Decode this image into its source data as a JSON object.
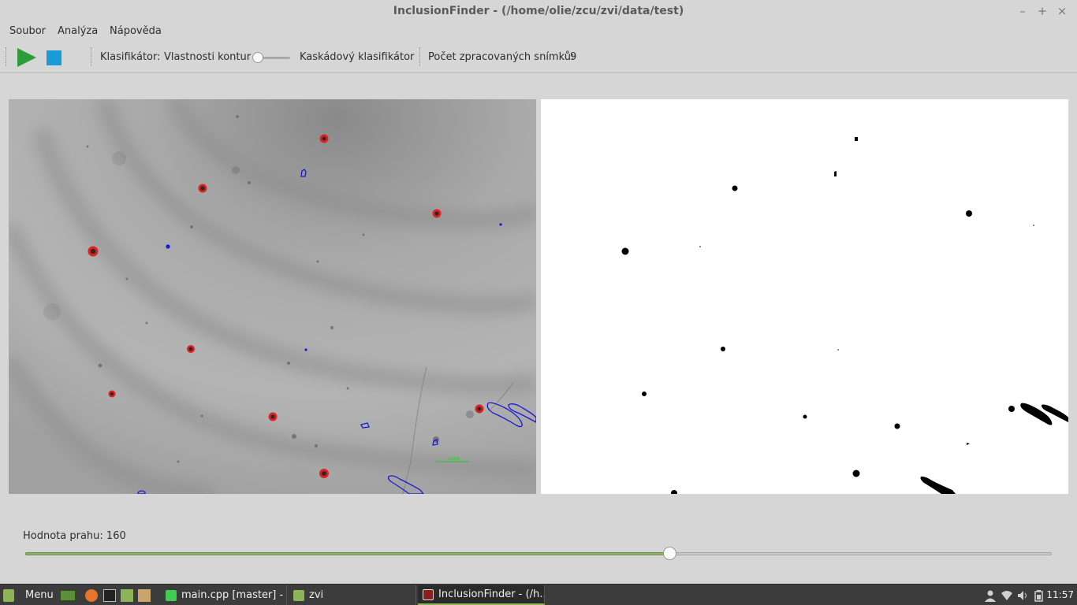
{
  "window": {
    "title": "InclusionFinder - (/home/olie/zcu/zvi/data/test)",
    "minimize_glyph": "–",
    "maximize_glyph": "+",
    "close_glyph": "×"
  },
  "menu": {
    "items": [
      "Soubor",
      "Analýza",
      "Nápověda"
    ]
  },
  "toolbar": {
    "play_icon": "play-icon",
    "stop_icon": "stop-icon",
    "classifier_label": "Klasifikátor:",
    "classifier_left_option": "Vlastnosti kontur",
    "classifier_right_option": "Kaskádový klasifikátor",
    "classifier_switch_value": 0,
    "processed_label": "Počet zpracovaných snímků:",
    "processed_count": "9",
    "colors": {
      "play": "#2a9d3a",
      "stop": "#1a9ad6"
    }
  },
  "views": {
    "left": {
      "name": "original-image-with-detections",
      "scale_label": "1mm",
      "detection_colors": {
        "classified": "#e02020",
        "unclassified": "#1a1ad8",
        "scale": "#22cc22"
      }
    },
    "right": {
      "name": "thresholded-binary-image"
    }
  },
  "threshold": {
    "label": "Hodnota prahu: 160",
    "value": 160,
    "max": 255,
    "fill_color": "#8fb36a"
  },
  "taskbar": {
    "menu_label": "Menu",
    "launchers": [
      "show-desktop-icon",
      "firefox-icon",
      "terminal-icon",
      "files-icon",
      "clapper-icon"
    ],
    "tasks": [
      {
        "label": "main.cpp [master] - ...",
        "icon": "qtcreator-icon",
        "active": false
      },
      {
        "label": "zvi",
        "icon": "folder-icon",
        "active": false
      },
      {
        "label": "InclusionFinder - (/h...",
        "icon": "app-icon",
        "active": true
      }
    ],
    "tray": [
      "user-icon",
      "wifi-icon",
      "volume-icon",
      "battery-icon"
    ],
    "clock": "11:57"
  }
}
